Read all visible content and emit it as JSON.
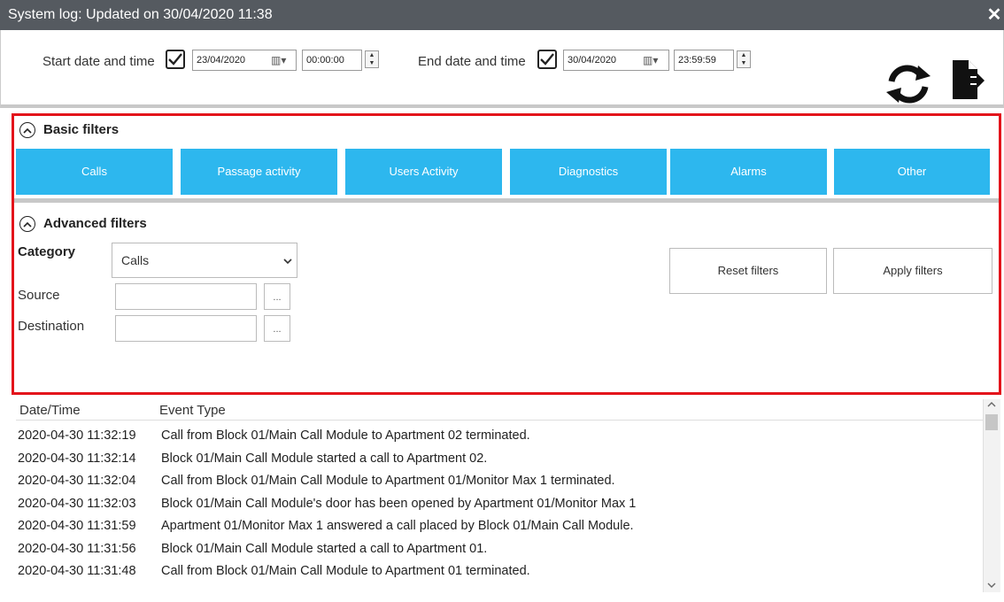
{
  "window": {
    "title": "System log: Updated on 30/04/2020 11:38",
    "close_glyph": "✕"
  },
  "toolbar": {
    "start_label": "Start date and time",
    "start_date": "23/04/2020",
    "start_time": "00:00:00",
    "end_label": "End date and time",
    "end_date": "30/04/2020",
    "end_time": "23:59:59",
    "calendar_glyph": "▥▾",
    "icons": [
      "refresh-icon",
      "export-icon"
    ]
  },
  "basic_filters": {
    "title": "Basic filters",
    "buttons": [
      "Calls",
      "Passage activity",
      "Users Activity",
      "Diagnostics",
      "Alarms",
      "Other"
    ],
    "accent": "#2db7ee"
  },
  "advanced_filters": {
    "title": "Advanced filters",
    "category_label": "Category",
    "category_value": "Calls",
    "source_label": "Source",
    "destination_label": "Destination",
    "browse_glyph": "...",
    "reset_label": "Reset filters",
    "apply_label": "Apply filters"
  },
  "highlight_color": "#e3141b",
  "log": {
    "columns": [
      "Date/Time",
      "Event Type"
    ],
    "rows": [
      {
        "datetime": "2020-04-30 11:32:19",
        "event": "Call from Block 01/Main Call Module to Apartment 02 terminated."
      },
      {
        "datetime": "2020-04-30 11:32:14",
        "event": "Block 01/Main Call Module started a call to Apartment 02."
      },
      {
        "datetime": "2020-04-30 11:32:04",
        "event": "Call from Block 01/Main Call Module to Apartment 01/Monitor Max 1 terminated."
      },
      {
        "datetime": "2020-04-30 11:32:03",
        "event": "Block 01/Main Call Module's door has been opened by Apartment 01/Monitor Max 1"
      },
      {
        "datetime": "2020-04-30 11:31:59",
        "event": "Apartment 01/Monitor Max 1 answered a call placed by Block 01/Main Call Module."
      },
      {
        "datetime": "2020-04-30 11:31:56",
        "event": "Block 01/Main Call Module started a call to Apartment 01."
      },
      {
        "datetime": "2020-04-30 11:31:48",
        "event": "Call from Block 01/Main Call Module to Apartment 01 terminated."
      }
    ]
  }
}
